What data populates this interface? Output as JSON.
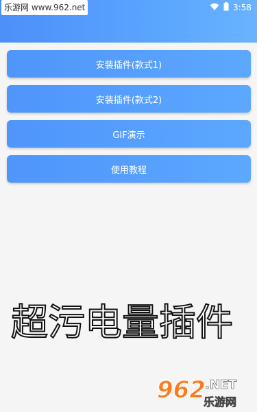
{
  "status_bar": {
    "watermark": "乐游网 www.962.net",
    "time": "3:58",
    "wifi_icon": "wifi-icon",
    "battery_icon": "battery-icon"
  },
  "menu": {
    "items": [
      {
        "label": "安装插件(款式1)"
      },
      {
        "label": "安装插件(款式2)"
      },
      {
        "label": "GIF演示"
      },
      {
        "label": "使用教程"
      }
    ]
  },
  "title": "超污电量插件",
  "logo": {
    "num": "962",
    "net": ".NET",
    "cn": "乐游网"
  },
  "colors": {
    "header_gradient_start": "#4d8ffa",
    "header_gradient_end": "#69b3ff",
    "button_blue": "#5aa0ff",
    "background": "#f5f5f5",
    "logo_orange": "#ff7a1a"
  }
}
